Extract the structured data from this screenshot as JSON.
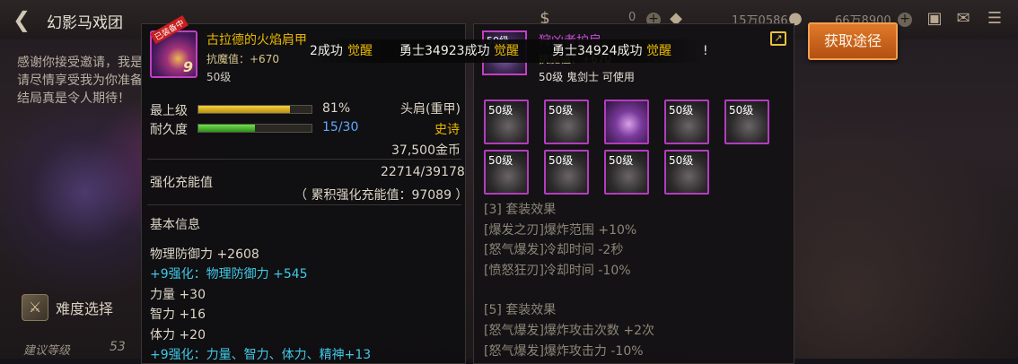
{
  "header": {
    "title": "幻影马戏团",
    "currencies": [
      {
        "value": "0"
      },
      {
        "value": "15万0586"
      },
      {
        "value": "66万8900"
      }
    ]
  },
  "intro": {
    "lines": [
      "感谢你接受邀请，我是",
      "请尽情享受我为你准备",
      "结局真是令人期待！"
    ]
  },
  "difficulty": {
    "label": "难度选择"
  },
  "suggest": {
    "label": "建议等级",
    "value": "53"
  },
  "toast": {
    "prefix": "2成功",
    "prefix_awaken": "觉醒",
    "main": "勇士34923成功",
    "main_awaken": "觉醒",
    "second": "勇士34924成功",
    "second_awaken": "觉醒",
    "tail": "!"
  },
  "left_item": {
    "equipped_tag": "已装备中",
    "enhance": "9",
    "name": "古拉德的火焰肩甲",
    "resist": "抗魔值：+670",
    "level": "50级",
    "max_level_label": "最上级",
    "max_level_pct": "81%",
    "max_level_fraction": 0.81,
    "slot": "头肩(重甲)",
    "durability_label": "耐久度",
    "durability_value": "15/30",
    "durability_fraction": 0.5,
    "rarity": "史诗",
    "price": "37,500金币",
    "charge_label": "强化充能值",
    "charge_value": "22714/39178",
    "charge_accum": "（ 累积强化充能值：97089 ）",
    "basic_info_label": "基本信息",
    "stats": [
      {
        "text": "物理防御力 +2608",
        "style": "normal"
      },
      {
        "text": "+9强化：物理防御力 +545",
        "style": "cyan"
      },
      {
        "text": "力量 +30",
        "style": "normal"
      },
      {
        "text": "智力 +16",
        "style": "normal"
      },
      {
        "text": "体力 +20",
        "style": "normal"
      },
      {
        "text": "+9强化：力量、智力、体力、精神+13",
        "style": "cyan"
      }
    ]
  },
  "right_item": {
    "level": "50级",
    "name": "狩凶者护肩",
    "resist": "抗魔值：+670",
    "class_info": "50级 鬼剑士 可使用",
    "slots": [
      "50级",
      "50级",
      "",
      "50级",
      "50级",
      "50级",
      "50级",
      "50级",
      "50级"
    ],
    "set_lines": [
      "[3] 套装效果",
      "[爆发之刃]爆炸范围 +10%",
      "[怒气爆发]冷却时间 -2秒",
      "[愤怒狂刃]冷却时间 -10%",
      "",
      "[5] 套装效果",
      "[怒气爆发]爆炸攻击次数 +2次",
      "[怒气爆发]爆炸攻击力 -10%"
    ]
  },
  "source_button": {
    "label": "获取途径"
  },
  "colors": {
    "epic": "#e8b800",
    "legendary": "#c84ad8",
    "enhance": "#3fc9e6",
    "button": "#d06a22"
  }
}
